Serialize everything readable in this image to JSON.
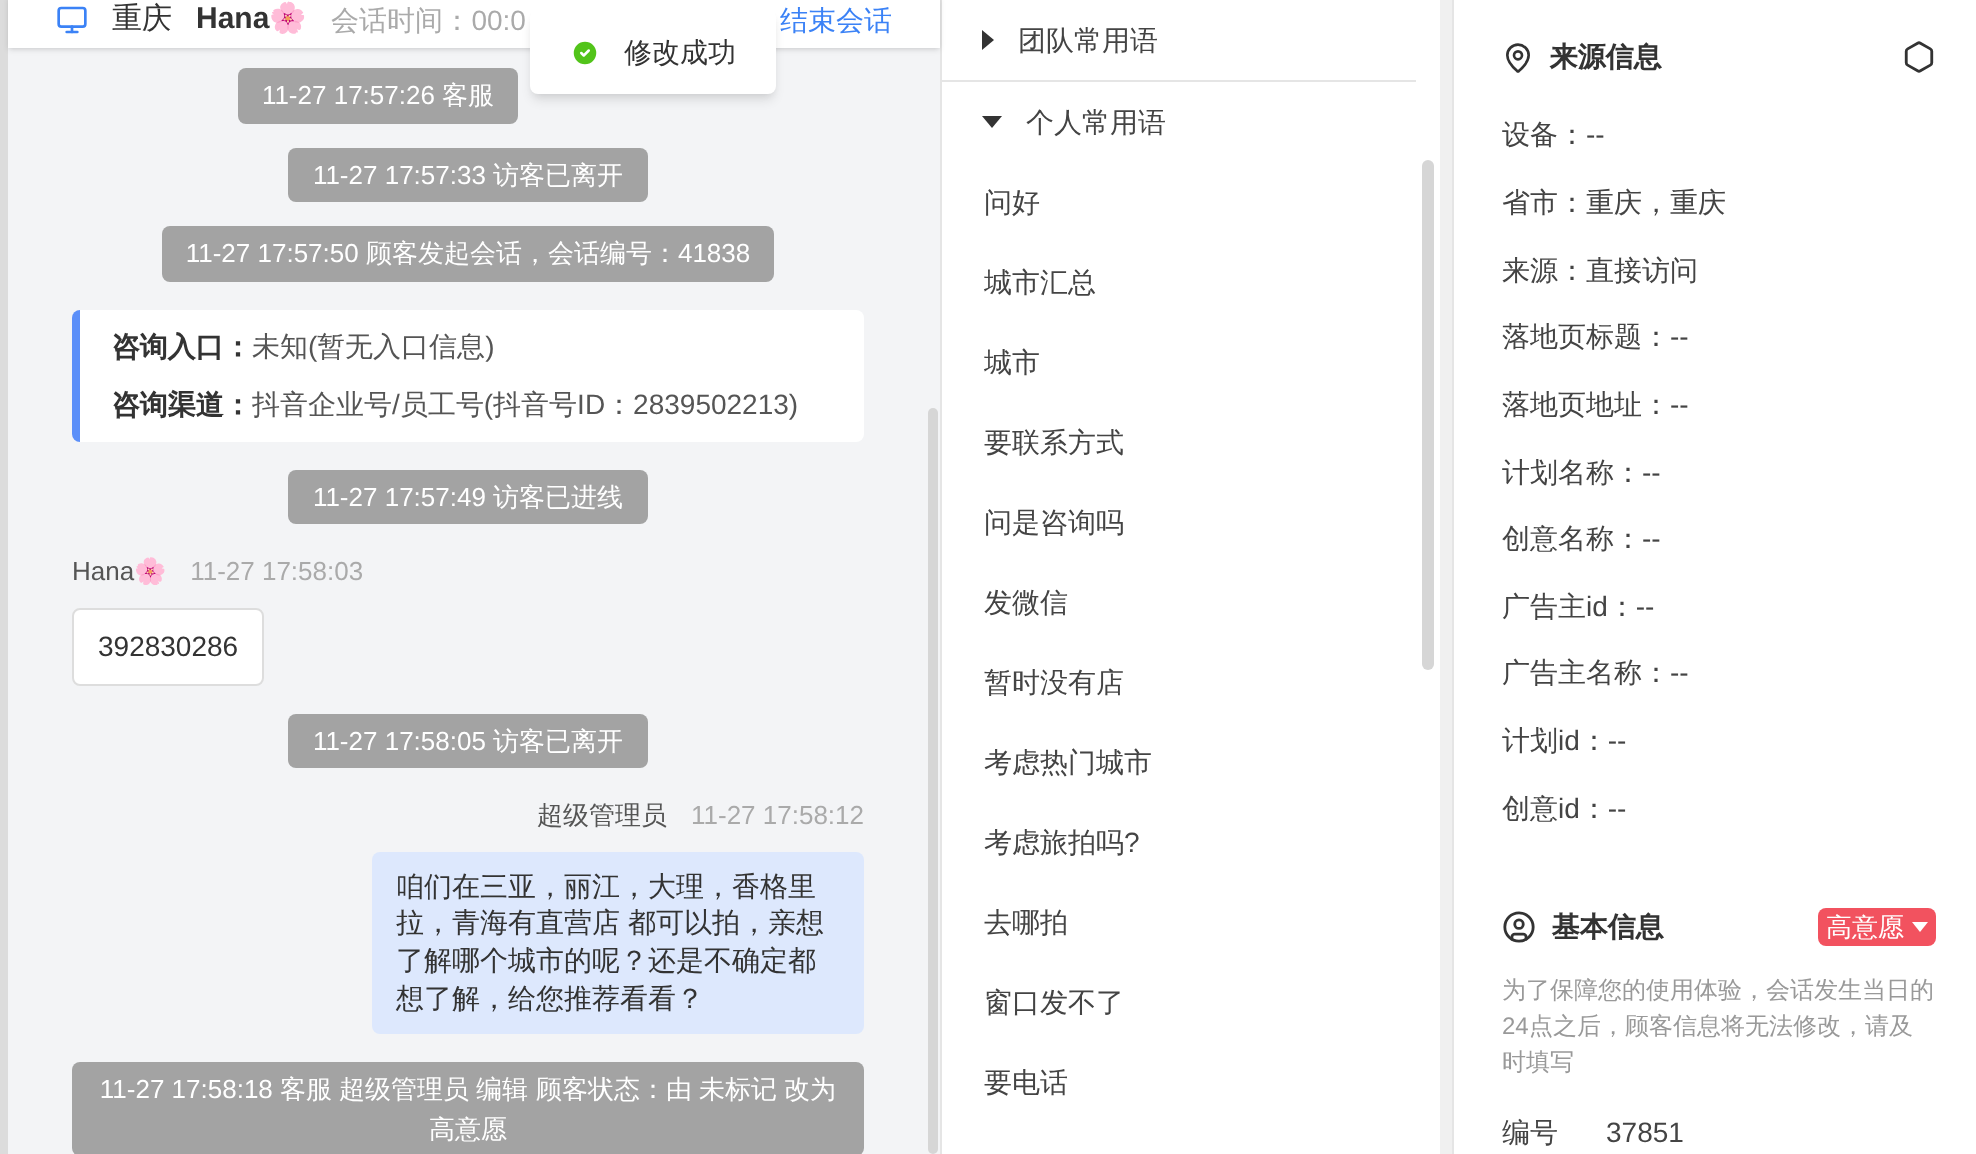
{
  "header": {
    "city": "重庆",
    "visitor": "Hana🌸",
    "session_time": "会话时间：00:0",
    "end_button": "结束会话"
  },
  "toast": {
    "text": "修改成功"
  },
  "chat": [
    {
      "kind": "system",
      "text": "11-27 17:57:26 客服"
    },
    {
      "kind": "system",
      "text": "11-27 17:57:33 访客已离开"
    },
    {
      "kind": "system",
      "text": "11-27 17:57:50 顾客发起会话，会话编号：41838"
    },
    {
      "kind": "info",
      "lines": [
        {
          "label": "咨询入口：",
          "value": "未知(暂无入口信息)"
        },
        {
          "label": "咨询渠道：",
          "value": "抖音企业号/员工号(抖音号ID：2839502213)"
        }
      ]
    },
    {
      "kind": "system",
      "text": "11-27 17:57:49 访客已进线"
    },
    {
      "kind": "visitor",
      "name": "Hana🌸",
      "time": "11-27 17:58:03",
      "text": "392830286"
    },
    {
      "kind": "system",
      "text": "11-27 17:58:05 访客已离开"
    },
    {
      "kind": "agent",
      "name": "超级管理员",
      "time": "11-27 17:58:12",
      "text": "咱们在三亚，丽江，大理，香格里拉，青海有直营店 都可以拍，亲想了解哪个城市的呢？还是不确定都想了解，给您推荐看看？"
    },
    {
      "kind": "system",
      "text": "11-27 17:58:18 客服 超级管理员 编辑 顾客状态：由 未标记 改为高意愿"
    }
  ],
  "phrases": {
    "groups": [
      {
        "title": "团队常用语",
        "expanded": false
      },
      {
        "title": "个人常用语",
        "expanded": true,
        "items": [
          "问好",
          "城市汇总",
          "城市",
          "要联系方式",
          "问是咨询吗",
          "发微信",
          "暂时没有店",
          "考虑热门城市",
          "考虑旅拍吗?",
          "去哪拍",
          "窗口发不了",
          "要电话"
        ]
      }
    ]
  },
  "source_info": {
    "title": "来源信息",
    "fields": [
      "设备：--",
      "省市：重庆，重庆",
      "来源：直接访问",
      "落地页标题：--",
      "落地页地址：--",
      "计划名称：--",
      "创意名称：--",
      "广告主id：--",
      "广告主名称：--",
      "计划id：--",
      "创意id：--"
    ]
  },
  "basic_info": {
    "title": "基本信息",
    "tag": "高意愿",
    "notice": "为了保障您的使用体验，会话发生当日的24点之后，顾客信息将无法修改，请及时填写",
    "fields": [
      {
        "label": "编号",
        "value": "37851"
      }
    ]
  }
}
